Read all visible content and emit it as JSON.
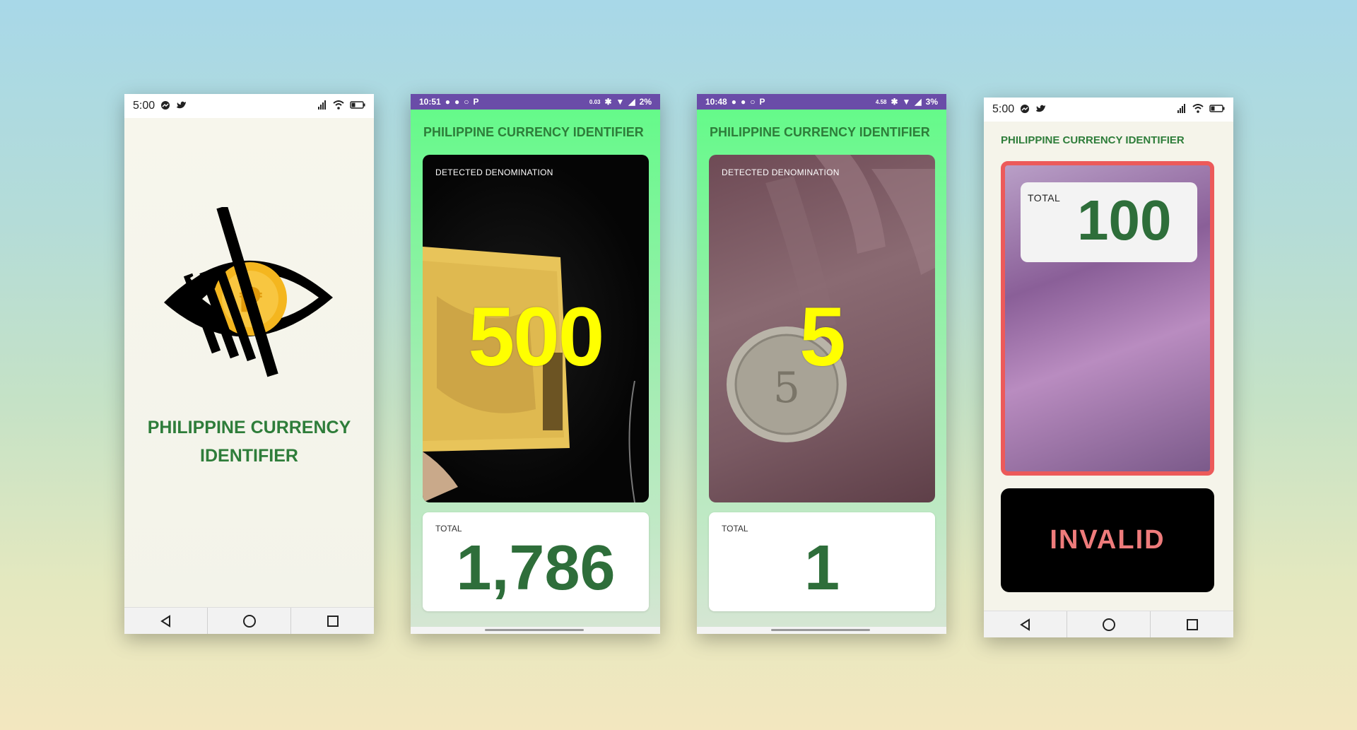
{
  "phones": [
    {
      "status": {
        "time": "5:00"
      },
      "app_title": "PHILIPPINE CURRENCY IDENTIFIER"
    },
    {
      "status": {
        "time": "10:51",
        "speed": "0.03",
        "battery": "2%"
      },
      "app_title": "PHILIPPINE CURRENCY IDENTIFIER",
      "camera": {
        "label": "DETECTED DENOMINATION",
        "value": "500"
      },
      "total": {
        "label": "TOTAL",
        "value": "1,786"
      }
    },
    {
      "status": {
        "time": "10:48",
        "speed": "4.58",
        "battery": "3%"
      },
      "app_title": "PHILIPPINE CURRENCY IDENTIFIER",
      "camera": {
        "label": "DETECTED DENOMINATION",
        "value": "5"
      },
      "total": {
        "label": "TOTAL",
        "value": "1"
      }
    },
    {
      "status": {
        "time": "5:00"
      },
      "app_title": "PHILIPPINE CURRENCY IDENTIFIER",
      "total": {
        "label": "TOTAL",
        "value": "100"
      },
      "result": "INVALID"
    }
  ],
  "colors": {
    "brand_green": "#2e7d3a",
    "detected_yellow": "#ffff00",
    "invalid_red": "#ee7b7b",
    "status_purple": "#6a4ca8"
  },
  "icons": [
    "messenger-icon",
    "twitter-icon",
    "signal-icon",
    "wifi-icon",
    "battery-icon",
    "back-icon",
    "home-icon",
    "recents-icon",
    "eye-logo-icon"
  ]
}
